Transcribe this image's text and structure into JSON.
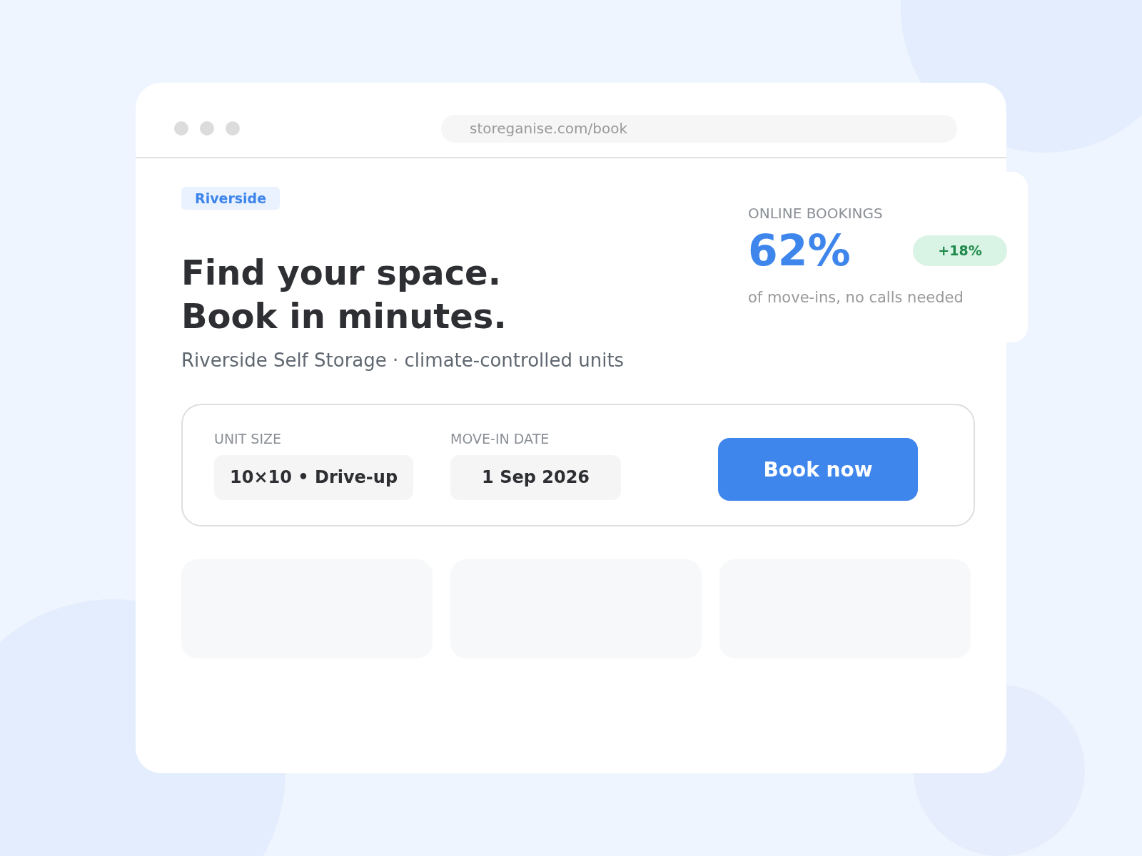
{
  "browser": {
    "url": "storeganise.com/book"
  },
  "hero": {
    "badge": "Riverside",
    "title_lines": [
      "Find your space.",
      "Book in minutes."
    ],
    "subtitle": "Riverside Self Storage · climate-controlled units"
  },
  "stat_card": {
    "label": "ONLINE BOOKINGS",
    "value": "62%",
    "change": "+18%",
    "caption": "of move-ins, no calls needed"
  },
  "booking_form": {
    "fields": [
      {
        "label": "UNIT SIZE",
        "value": "10×10 • Drive-up"
      },
      {
        "label": "MOVE-IN DATE",
        "value": "1 Sep 2026"
      }
    ],
    "button": "Book now"
  },
  "cards": [
    {
      "kind": "skeleton"
    },
    {
      "kind": "skeleton"
    },
    {
      "kind": "skeleton"
    }
  ]
}
